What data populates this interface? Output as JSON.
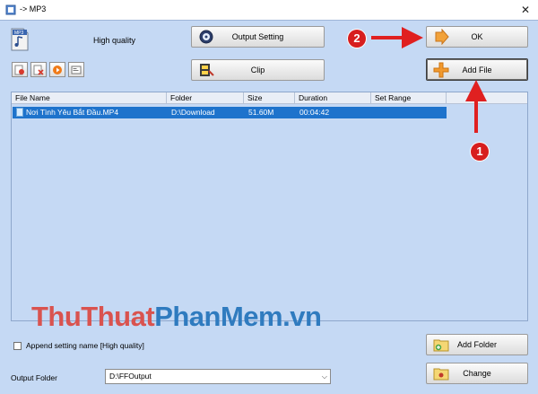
{
  "window": {
    "title": "-> MP3",
    "close_symbol": "✕"
  },
  "quality": {
    "label": "High quality",
    "icon": "mp3-file-icon"
  },
  "buttons": {
    "output_setting": "Output Setting",
    "clip": "Clip",
    "ok": "OK",
    "add_file": "Add File",
    "add_folder": "Add Folder",
    "change": "Change"
  },
  "table": {
    "columns": [
      "File Name",
      "Folder",
      "Size",
      "Duration",
      "Set Range"
    ],
    "rows": [
      {
        "file_name": "Nơi Tình Yêu Bắt Đầu.MP4",
        "folder": "D:\\Download",
        "size": "51.60M",
        "duration": "00:04:42",
        "set_range": ""
      }
    ]
  },
  "append_setting": {
    "label": "Append setting name [High quality]",
    "checked": false
  },
  "output": {
    "label": "Output Folder",
    "value": "D:\\FFOutput"
  },
  "watermark": {
    "part1": "ThuThuat",
    "part2": "PhanMem",
    "part3": ".vn"
  },
  "annotations": {
    "badge1": "1",
    "badge2": "2",
    "color": "#e02020"
  },
  "colors": {
    "client_bg": "#c5d9f4",
    "selection": "#1e73cc"
  }
}
